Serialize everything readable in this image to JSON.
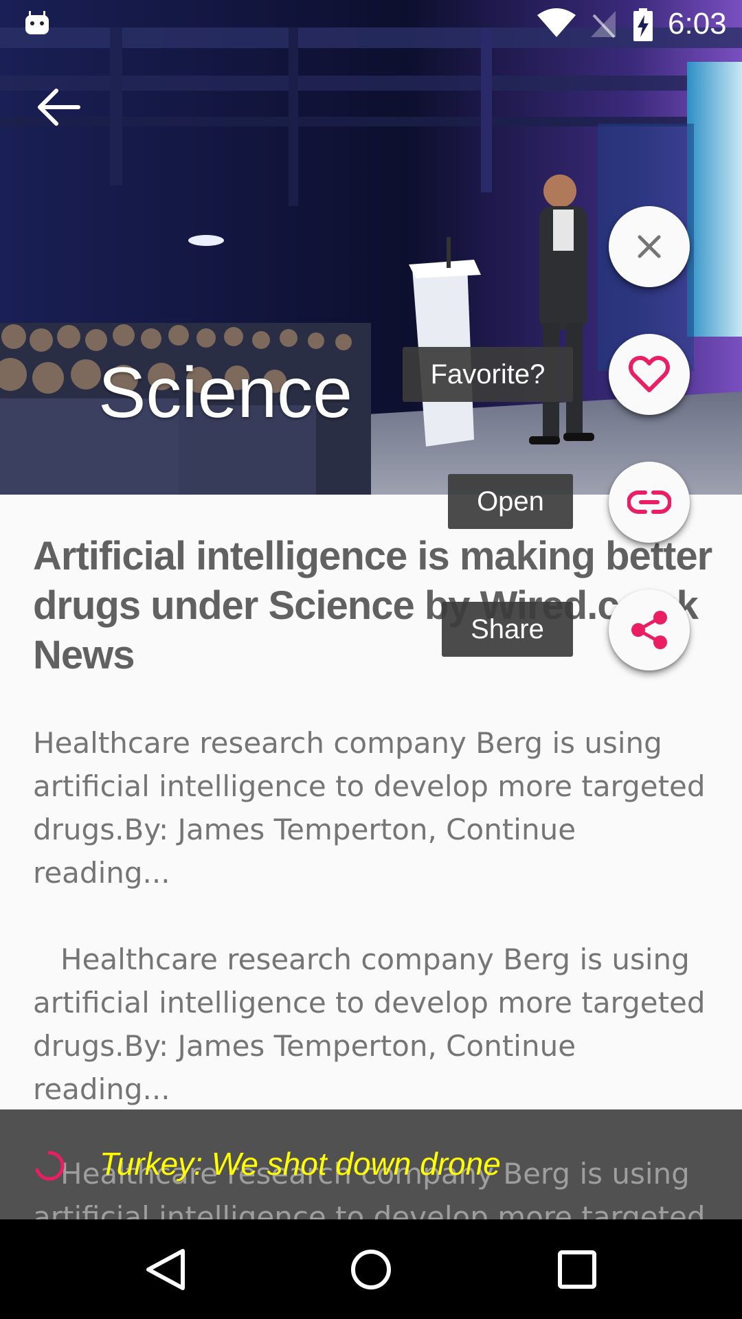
{
  "status_bar": {
    "time": "6:03"
  },
  "header": {
    "category": "Science"
  },
  "article": {
    "title": "Artificial intelligence is making better drugs under Science by Wired.co.uk News",
    "paragraph_1": "Healthcare research company Berg is using artificial intelligence to develop more targeted drugs.By: James Temperton, Continue reading...",
    "paragraph_2": "Healthcare research company Berg is using artificial intelligence to develop more targeted drugs.By: James Temperton, Continue reading...",
    "paragraph_3": "Healthcare research company Berg is using artificial intelligence to develop more targeted"
  },
  "fab_menu": {
    "favorite_label": "Favorite?",
    "open_label": "Open",
    "share_label": "Share"
  },
  "ticker": {
    "headline": "Turkey: We shot down drone"
  },
  "colors": {
    "accent": "#e91e63",
    "ticker_text": "#ffff00"
  },
  "icons": {
    "back": "arrow-left-icon",
    "close": "close-icon",
    "favorite": "heart-outline-icon",
    "open": "link-icon",
    "share": "share-icon"
  }
}
